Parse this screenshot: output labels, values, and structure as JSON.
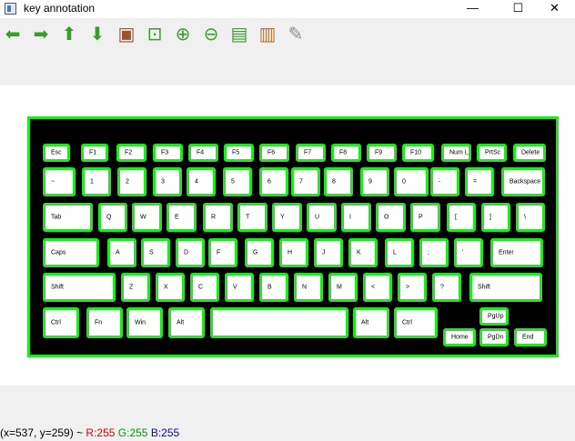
{
  "window": {
    "title": "key annotation",
    "minimize": "—",
    "maximize": "☐",
    "close": "✕"
  },
  "toolbar": [
    {
      "name": "arrow-left-icon",
      "glyph": "⬅",
      "color": "#3a9d2b"
    },
    {
      "name": "arrow-right-icon",
      "glyph": "➡",
      "color": "#3a9d2b"
    },
    {
      "name": "arrow-up-icon",
      "glyph": "⬆",
      "color": "#3a9d2b"
    },
    {
      "name": "arrow-down-icon",
      "glyph": "⬇",
      "color": "#3a9d2b"
    },
    {
      "name": "image-icon",
      "glyph": "▣",
      "color": "#a0522d"
    },
    {
      "name": "zoom-area-icon",
      "glyph": "⊡",
      "color": "#3a9d2b"
    },
    {
      "name": "zoom-in-icon",
      "glyph": "⊕",
      "color": "#3a9d2b"
    },
    {
      "name": "zoom-out-icon",
      "glyph": "⊖",
      "color": "#3a9d2b"
    },
    {
      "name": "save-icon",
      "glyph": "▤",
      "color": "#3a9d2b"
    },
    {
      "name": "clipboard-icon",
      "glyph": "▥",
      "color": "#c0702a"
    },
    {
      "name": "brush-icon",
      "glyph": "✎",
      "color": "#8a8a8a"
    }
  ],
  "keyboard": {
    "annotation_color": "#22e622",
    "keys": [
      "Esc",
      "F1",
      "F2",
      "F3",
      "F4",
      "F5",
      "F6",
      "F7",
      "F8",
      "F9",
      "F10",
      "Num Lock",
      "PrtSc",
      "Delete",
      "~",
      "1",
      "2",
      "3",
      "4",
      "5",
      "6",
      "7",
      "8",
      "9",
      "0",
      "-",
      "=",
      "Backspace",
      "Tab",
      "Q",
      "W",
      "E",
      "R",
      "T",
      "Y",
      "U",
      "I",
      "O",
      "P",
      "[",
      "]",
      "\\",
      "Caps",
      "A",
      "S",
      "D",
      "F",
      "G",
      "H",
      "J",
      "K",
      "L",
      ";",
      "'",
      "Enter",
      "Shift",
      "Z",
      "X",
      "C",
      "V",
      "B",
      "N",
      "M",
      "<",
      ">",
      "?",
      "Shift",
      "Ctrl",
      "Fn",
      "Win",
      "Alt",
      "",
      "Alt",
      "Ctrl",
      "PgUp",
      "Home",
      "PgDn",
      "End"
    ]
  },
  "status": {
    "coords": "(x=537, y=259) ~ ",
    "r": "R:255",
    "g": "G:255",
    "b": "B:255",
    "r_color": "#e00000",
    "g_color": "#009900",
    "b_color": "#0000dd"
  }
}
